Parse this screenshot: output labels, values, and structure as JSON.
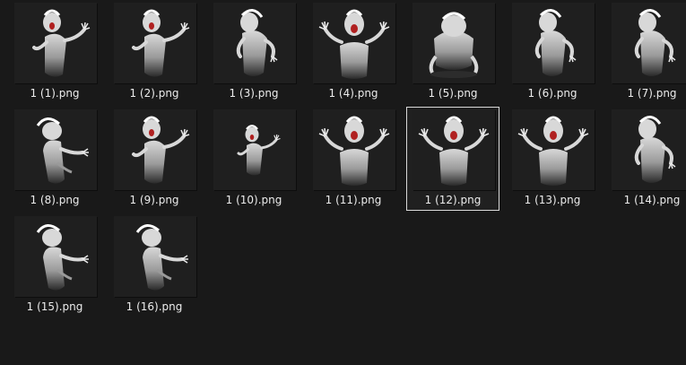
{
  "files": [
    {
      "name": "1 (1).png",
      "selected": false,
      "pose": "reach-right"
    },
    {
      "name": "1 (2).png",
      "selected": false,
      "pose": "reach-right"
    },
    {
      "name": "1 (3).png",
      "selected": false,
      "pose": "hunched"
    },
    {
      "name": "1 (4).png",
      "selected": false,
      "pose": "arms-open"
    },
    {
      "name": "1 (5).png",
      "selected": false,
      "pose": "crouched"
    },
    {
      "name": "1 (6).png",
      "selected": false,
      "pose": "hunched"
    },
    {
      "name": "1 (7).png",
      "selected": false,
      "pose": "hunched"
    },
    {
      "name": "1 (8).png",
      "selected": false,
      "pose": "side-left"
    },
    {
      "name": "1 (9).png",
      "selected": false,
      "pose": "reach-right"
    },
    {
      "name": "1 (10).png",
      "selected": false,
      "pose": "small"
    },
    {
      "name": "1 (11).png",
      "selected": false,
      "pose": "arms-open"
    },
    {
      "name": "1 (12).png",
      "selected": true,
      "pose": "front"
    },
    {
      "name": "1 (13).png",
      "selected": false,
      "pose": "arms-open"
    },
    {
      "name": "1 (14).png",
      "selected": false,
      "pose": "hunched"
    },
    {
      "name": "1 (15).png",
      "selected": false,
      "pose": "side-left"
    },
    {
      "name": "1 (16).png",
      "selected": false,
      "pose": "reach-left"
    }
  ],
  "colors": {
    "background": "#191919",
    "label_text": "#ececec",
    "selection_border": "#d9d9d9",
    "creature_light": "#d8d8d8",
    "creature_mid": "#9a9a9a",
    "creature_dark": "#2a2a2a",
    "mouth": "#b02020"
  },
  "icon": "image-thumbnail"
}
